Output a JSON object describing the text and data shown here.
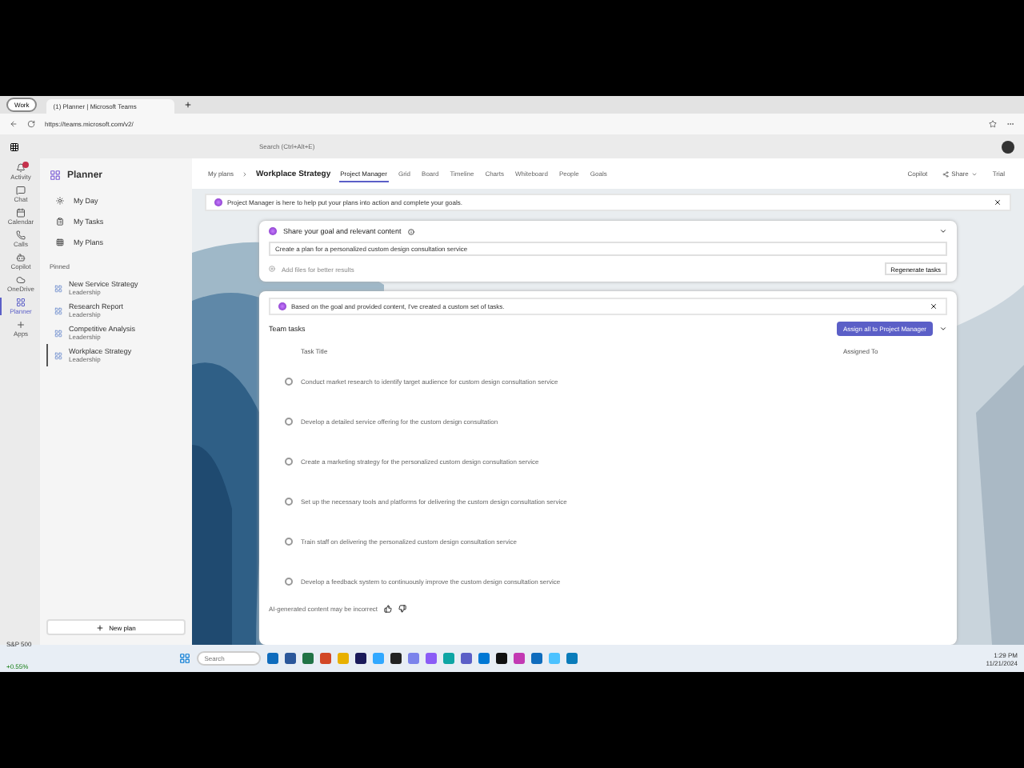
{
  "browser": {
    "profile": "Work",
    "tabs": [
      {
        "label": "(1) Planner | Microsoft Teams",
        "selected": true
      }
    ],
    "url": "https://teams.microsoft.com/v2/"
  },
  "teams": {
    "search": {
      "placeholder": "Search (Ctrl+Alt+E)"
    }
  },
  "rail": [
    {
      "label": "Activity",
      "selected": false,
      "notification": true
    },
    {
      "label": "Chat",
      "selected": false,
      "notification": false
    },
    {
      "label": "Calendar",
      "selected": false,
      "notification": false
    },
    {
      "label": "Calls",
      "selected": false,
      "notification": false
    },
    {
      "label": "Copilot",
      "selected": false,
      "notification": false
    },
    {
      "label": "OneDrive",
      "selected": false,
      "notification": false
    },
    {
      "label": "Planner",
      "selected": true,
      "notification": false
    },
    {
      "label": "Apps",
      "selected": false,
      "notification": false
    }
  ],
  "sidebar": {
    "title": "Planner",
    "nav": [
      "My Day",
      "My Tasks",
      "My Plans"
    ],
    "pinned_heading": "Pinned",
    "pinned": [
      {
        "name": "New Service Strategy",
        "group": "Leadership",
        "selected": false
      },
      {
        "name": "Research Report",
        "group": "Leadership",
        "selected": false
      },
      {
        "name": "Competitive Analysis",
        "group": "Leadership",
        "selected": false
      },
      {
        "name": "Workplace Strategy",
        "group": "Leadership",
        "selected": true
      }
    ],
    "new_plan": "New plan"
  },
  "header": {
    "breadcrumb": "My plans",
    "plan_title": "Workplace Strategy",
    "tabs": [
      {
        "label": "Project Manager",
        "selected": true
      },
      {
        "label": "Grid",
        "selected": false
      },
      {
        "label": "Board",
        "selected": false
      },
      {
        "label": "Timeline",
        "selected": false
      },
      {
        "label": "Charts",
        "selected": false
      },
      {
        "label": "Whiteboard",
        "selected": false
      },
      {
        "label": "People",
        "selected": false
      },
      {
        "label": "Goals",
        "selected": false
      }
    ],
    "copilot": "Copilot",
    "share": "Share",
    "trial": "Trial"
  },
  "banner": "Project Manager is here to help put your plans into action and complete your goals.",
  "goal_card": {
    "title": "Share your goal and relevant content",
    "value": "Create a plan for a personalized custom design consultation service",
    "add_files": "Add files for better results",
    "regenerate": "Regenerate tasks"
  },
  "tasks_card": {
    "notice": "Based on the goal and provided content, I've created a custom set of tasks.",
    "title": "Team tasks",
    "assign": "Assign all to Project Manager",
    "columns": [
      "Task Title",
      "Assigned To"
    ],
    "tasks": [
      {
        "title": "Conduct market research to identify target audience for custom design consultation service",
        "checked": false
      },
      {
        "title": "Develop a detailed service offering for the custom design consultation",
        "checked": false
      },
      {
        "title": "Create a marketing strategy for the personalized custom design consultation service",
        "checked": false
      },
      {
        "title": "Set up the necessary tools and platforms for delivering the custom design consultation service",
        "checked": false
      },
      {
        "title": "Train staff on delivering the personalized custom design consultation service",
        "checked": false
      },
      {
        "title": "Develop a feedback system to continuously improve the custom design consultation service",
        "checked": false
      }
    ],
    "footer": "AI-generated content may be incorrect"
  },
  "taskbar": {
    "stock": {
      "name": "S&P 500",
      "change": "+0.55%"
    },
    "search": {
      "placeholder": "Search"
    },
    "time": "1:29 PM",
    "date": "11/21/2024"
  }
}
